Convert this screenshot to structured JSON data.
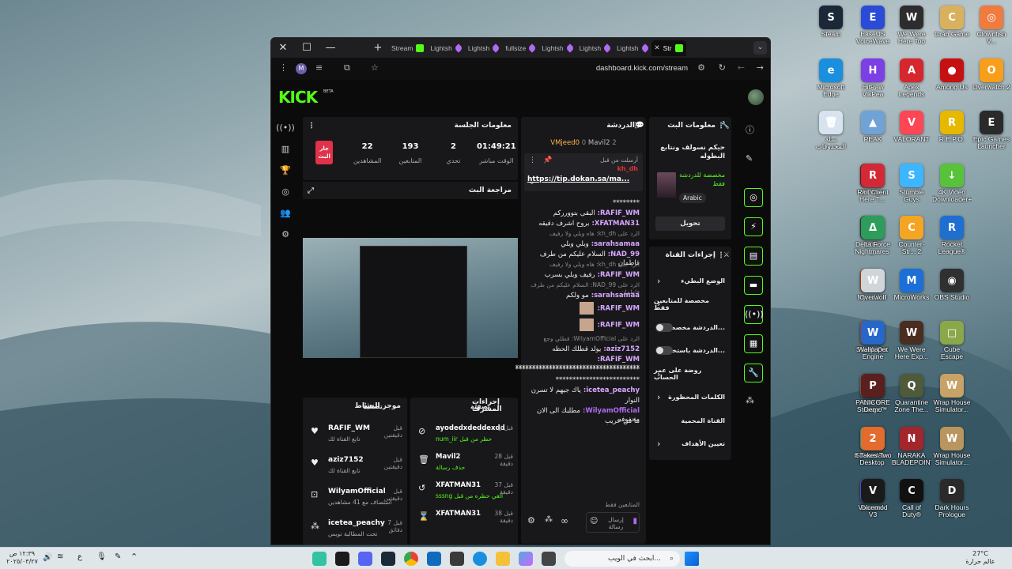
{
  "desktop": {
    "icons": [
      {
        "label": "Steam",
        "color": "#1b2838",
        "glyph": "S"
      },
      {
        "label": "EaseUS VoiceWave",
        "color": "#2a4bd7",
        "glyph": "E"
      },
      {
        "label": "We Were Here Too",
        "color": "#2d2d2d",
        "glyph": "W"
      },
      {
        "label": "Crab Game",
        "color": "#d9b15e",
        "glyph": "C"
      },
      {
        "label": "Clownfish V...",
        "color": "#f07b3f",
        "glyph": "◎"
      },
      {
        "label": "Microsoft Edge",
        "color": "#1a8fdd",
        "glyph": "e"
      },
      {
        "label": "HitPaw VikPea",
        "color": "#7b3fe4",
        "glyph": "H"
      },
      {
        "label": "Apex Legends",
        "color": "#d6262e",
        "glyph": "A"
      },
      {
        "label": "Among Us",
        "color": "#c51111",
        "glyph": "●"
      },
      {
        "label": "Overwatch 2",
        "color": "#f99e1a",
        "glyph": "O"
      },
      {
        "label": "سلة المحذوفات",
        "color": "#d7e3ef",
        "glyph": "🗑"
      },
      {
        "label": "PEAK",
        "color": "#6fa3d6",
        "glyph": "▲"
      },
      {
        "label": "VALORANT",
        "color": "#ff4655",
        "glyph": "V"
      },
      {
        "label": "R.E.P.O.",
        "color": "#e6b800",
        "glyph": "R"
      },
      {
        "label": "Epic Games Launcher",
        "color": "#2a2a2a",
        "glyph": "E"
      },
      {
        "label": "We Were Here T...",
        "color": "#6b1f1f",
        "glyph": "W"
      },
      {
        "label": "Riot Client",
        "color": "#d32936",
        "glyph": "R"
      },
      {
        "label": "Stumble Guys",
        "color": "#3db5ff",
        "glyph": "S"
      },
      {
        "label": "4K Video Downloader+",
        "color": "#59c23b",
        "glyph": "↓"
      },
      {
        "label": "Little Nightmares II",
        "color": "#3a3a3a",
        "glyph": "L"
      },
      {
        "label": "Delta Force",
        "color": "#2e9d5b",
        "glyph": "Δ"
      },
      {
        "label": "Counter-Str... 2",
        "color": "#f5a524",
        "glyph": "C"
      },
      {
        "label": "Rocket League®",
        "color": "#1f6fd1",
        "glyph": "R"
      },
      {
        "label": "Myrmidon",
        "color": "#c24a1d",
        "glyph": "M"
      },
      {
        "label": "Overwolf",
        "color": "#cfd5d8",
        "glyph": "W"
      },
      {
        "label": "MicroWorks",
        "color": "#1c6fd6",
        "glyph": "M"
      },
      {
        "label": "OBS Studio",
        "color": "#303030",
        "glyph": "◉"
      },
      {
        "label": "Sneak Out",
        "color": "#c5512a",
        "glyph": "S"
      },
      {
        "label": "Wallpaper Engine",
        "color": "#2667c9",
        "glyph": "W"
      },
      {
        "label": "We Were Here Exp...",
        "color": "#4a2d1f",
        "glyph": "W"
      },
      {
        "label": "Cube Escape Paradox",
        "color": "#8aa84a",
        "glyph": "□"
      },
      {
        "label": "Life is Strange™",
        "color": "#8b6a4a",
        "glyph": "L"
      },
      {
        "label": "PANICORE Demo",
        "color": "#5a1f1f",
        "glyph": "P"
      },
      {
        "label": "Quarantine Zone The...",
        "color": "#4e5a3a",
        "glyph": "Q"
      },
      {
        "label": "Wrap House Simulator...",
        "color": "#c8a266",
        "glyph": "W"
      },
      {
        "label": "Streamlabs Desktop",
        "color": "#31c3a2",
        "glyph": "S"
      },
      {
        "label": "It Takes Two",
        "color": "#e26b2d",
        "glyph": "2"
      },
      {
        "label": "NARAKA BLADEPOINT",
        "color": "#a3262c",
        "glyph": "N"
      },
      {
        "label": "Wrap House Simulator...",
        "color": "#b9955f",
        "glyph": "W"
      },
      {
        "label": "Discord",
        "color": "#5865f2",
        "glyph": "D"
      },
      {
        "label": "Voicemod V3",
        "color": "#1a1a1a",
        "glyph": "V"
      },
      {
        "label": "Call of Duty®",
        "color": "#111111",
        "glyph": "C"
      },
      {
        "label": "Dark Hours Prologue",
        "color": "#2a2a2a",
        "glyph": "D"
      }
    ]
  },
  "browser": {
    "tabs": [
      "Stream",
      "Lightsh",
      "Lightsh",
      "fullsize",
      "Lightsh",
      "Lightsh",
      "Lightsh",
      "Str"
    ],
    "url": "dashboard.kick.com/stream",
    "profile_initial": "M"
  },
  "kick": {
    "logo": "KICK",
    "beta": "BETA",
    "session": {
      "title": "معلومات الجلسة",
      "live_badge": "جار البث",
      "stats": [
        {
          "value": "22",
          "label": "المشاهدين"
        },
        {
          "value": "193",
          "label": "المتابعين"
        },
        {
          "value": "2",
          "label": "تحدي"
        },
        {
          "value": "01:49:21",
          "label": "الوقت مباشر"
        }
      ]
    },
    "preview_title": "مراجعة البث",
    "chat": {
      "title": "الدردشة",
      "top_users": [
        "VMjeed0",
        "Mavil2"
      ],
      "pinned_label": "أرسلت من قبل",
      "pinned_user": "kh_dh",
      "pinned_link": "https://tip.dokan.sa/ma...",
      "messages": [
        {
          "user": "",
          "text": "********"
        },
        {
          "user": "RAFIF_WM",
          "text": "البقى بتوورركم"
        },
        {
          "user": "XFATMAN31",
          "text": "بروح اشرف دقيقه"
        },
        {
          "reply": "الرد على kh_dh: هاه وبلي ولا رفيف"
        },
        {
          "user": "sarahsamaa",
          "text": "وبلي وبلي"
        },
        {
          "user": "NAD_99",
          "text": "السلام عليكم من طرف فاطمان"
        },
        {
          "reply": "الرد على kh_dh: هاه وبلي ولا رفيف"
        },
        {
          "user": "RAFIF_WM",
          "text": "رفيف وبلي بسرب"
        },
        {
          "reply": "الرد على NAD_99: السلام عليكم من طرف فاطمان"
        },
        {
          "user": "sarahsamaa",
          "text": "مو ولكم"
        },
        {
          "user": "RAFIF_WM",
          "text": ""
        },
        {
          "user": "RAFIF_WM",
          "text": ""
        },
        {
          "reply": "الرد على WilyamOfficial: قطلي وجع"
        },
        {
          "user": "aziz7152",
          "text": "يولد قطلك الحظه"
        },
        {
          "user": "RAFIF_WM",
          "text": "*************************************"
        },
        {
          "user": "",
          "text": "*************************************"
        },
        {
          "user": "",
          "text": "*************************"
        },
        {
          "user": "icetea_peachy",
          "text": "ياك جيهم لا تسرن"
        },
        {
          "user": "",
          "text": "النوار"
        },
        {
          "user": "WilyamOfficial",
          "text": "مطلبك الى الان محفوفه"
        },
        {
          "user": "",
          "text": "ما من عريب"
        }
      ],
      "followers_only": "المتابعين فقط",
      "input_placeholder": "إرسال رسالة"
    },
    "stream_info": {
      "title": "معلومات البث",
      "stream_title": "حيكم نسولف ونتابع البطوله",
      "category": "مخصصة للدردشة فقط",
      "language": "Arabic",
      "edit_button": "تحويل"
    },
    "channel_actions": {
      "title": "إجراءات القناة",
      "items": [
        {
          "label": "الوضع البطيء",
          "type": "chevron"
        },
        {
          "label": "مخصصة للمتابعين فقط",
          "type": "chevron"
        },
        {
          "label": "الدردشة مخصصة...",
          "type": "toggle"
        },
        {
          "label": "الدردشة باستخدام...",
          "type": "toggle"
        },
        {
          "label": "روضة على عمر الحساب",
          "type": "chevron"
        },
        {
          "label": "الكلمات المحظورة",
          "type": "chevron"
        },
        {
          "label": "القناة المحمية",
          "type": "none"
        },
        {
          "label": "تعيين الأهداف",
          "type": "chevron"
        }
      ]
    },
    "activity": {
      "title": "موجز النشاط",
      "filter": "تصفية",
      "items": [
        {
          "name": "RAFIF_WM",
          "sub": "تابع القناة لك",
          "time": "قبل دقيقتين"
        },
        {
          "name": "aziz7152",
          "sub": "تابع القناة لك",
          "time": "قبل دقيقتين"
        },
        {
          "name": "WilyamOfficial",
          "sub": "استضاف مع 41 مشاهدين",
          "time": "قبل دقيقتين"
        },
        {
          "name": "icetea_peachy",
          "sub": "تحت المطالبة تويس",
          "time": "قبل 7 دقائق"
        }
      ]
    },
    "mod_actions": {
      "title": "إجراءات المشرف",
      "filter": "تصفية",
      "items": [
        {
          "name": "ayodedxdeddexdd",
          "sub": "num_iir حظر من قبل",
          "time": "قبل ل"
        },
        {
          "name": "Mavil2",
          "sub": "حذف رسالة",
          "time": "قبل 28 دقيقة"
        },
        {
          "name": "XFATMAN31",
          "sub": "sssng الغي حظره من قبل",
          "time": "قبل 37 دقيقة"
        },
        {
          "name": "XFATMAN31",
          "sub": "",
          "time": "قبل 38 دقيقة"
        }
      ]
    }
  },
  "taskbar": {
    "search_placeholder": "ابحث في الويب...",
    "time": "١٢:٣٩ ص",
    "date": "٢٠٢٥/٠٣/٢٧",
    "weather_temp": "27°C",
    "weather_desc": "عالم حرارة",
    "lang": "ع"
  }
}
